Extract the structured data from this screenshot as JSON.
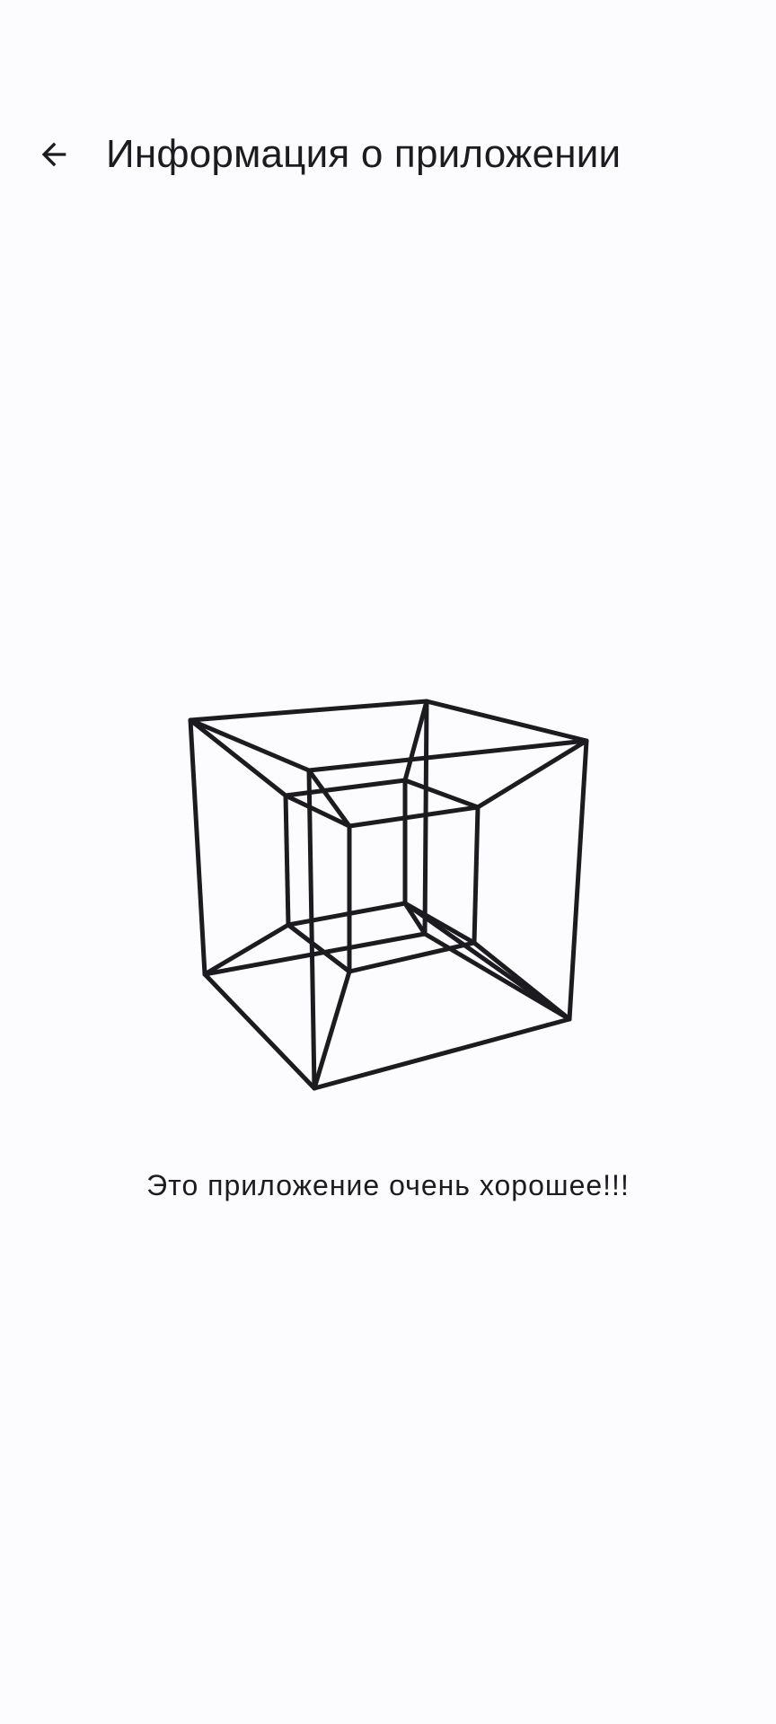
{
  "header": {
    "title": "Информация о приложении",
    "back_icon": "arrow-back-icon"
  },
  "main": {
    "image_icon": "tesseract-icon",
    "description": "Это приложение очень хорошее!!!"
  },
  "colors": {
    "background": "#fcfcfe",
    "text": "#1c1b1f",
    "stroke": "#1c1b1f"
  }
}
